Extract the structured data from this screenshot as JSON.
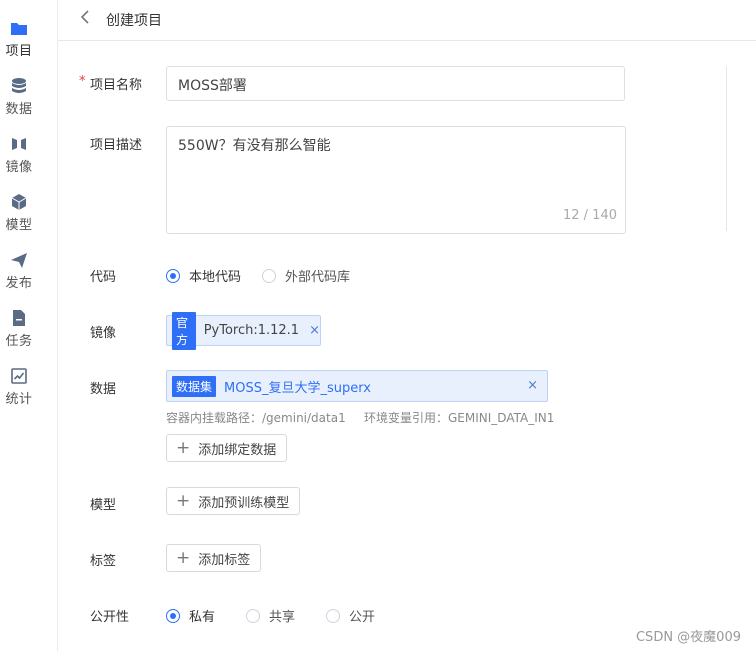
{
  "sidebar": {
    "items": [
      {
        "label": "项目",
        "icon": "folder-icon"
      },
      {
        "label": "数据",
        "icon": "database-icon"
      },
      {
        "label": "镜像",
        "icon": "mirror-icon"
      },
      {
        "label": "模型",
        "icon": "cube-icon"
      },
      {
        "label": "发布",
        "icon": "send-icon"
      },
      {
        "label": "任务",
        "icon": "task-icon"
      },
      {
        "label": "统计",
        "icon": "chart-icon"
      }
    ]
  },
  "header": {
    "back_icon": "chevron-left-icon",
    "title": "创建项目"
  },
  "form": {
    "required_mark": "*",
    "name_label": "项目名称",
    "name_value": "MOSS部署",
    "desc_label": "项目描述",
    "desc_value": "550W？有没有那么智能",
    "desc_count": "12 / 140",
    "code_label": "代码",
    "code_options": [
      "本地代码",
      "外部代码库"
    ],
    "image_label": "镜像",
    "image_tag_badge": "官方",
    "image_tag_name": "PyTorch:1.12.1",
    "data_label": "数据",
    "data_tag_badge": "数据集",
    "data_tag_name": "MOSS_复旦大学_superx",
    "mount_path": "容器内挂载路径：/gemini/data1",
    "env_ref": "环境变量引用：GEMINI_DATA_IN1",
    "add_data_btn": "添加绑定数据",
    "model_label": "模型",
    "add_model_btn": "添加预训练模型",
    "tag_label": "标签",
    "add_tag_btn": "添加标签",
    "visibility_label": "公开性",
    "visibility_options": [
      "私有",
      "共享",
      "公开"
    ],
    "close_glyph": "×",
    "plus_glyph": "+"
  },
  "watermark": "CSDN @夜魔009",
  "colors": {
    "accent": "#2f6ff7",
    "sidebar_icon": "#5a6b86",
    "active_icon": "#2f6ff7"
  }
}
